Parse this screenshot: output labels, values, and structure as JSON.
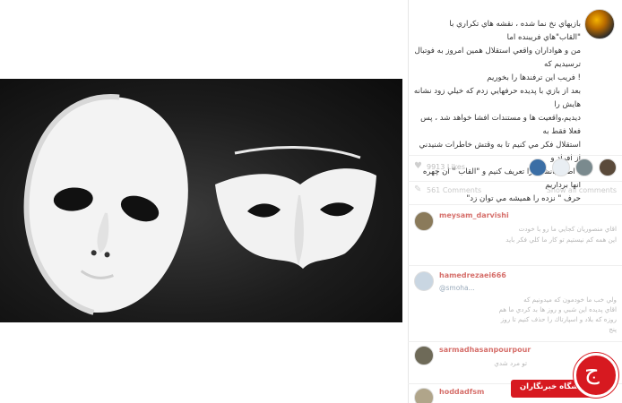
{
  "post": {
    "caption_lines": [
      "بازيهاي نخ نما شده ، نقشه هاي تكراري با \"القاب\"هاي فريبنده اما",
      "من و هواداران واقعي استقلال همين امروز به فوتبال ترسيديم كه",
      "! فريب اين ترفندها را بخوريم",
      "بعد از بازي با پديده حرفهايي زدم كه خيلي زود نشانه هايش را",
      "ديديم،واقعيت ها و مستندات افشا خواهد شد ، پس فعلا فقط به",
      "استقلال فكر مي كنيم تا به وقتش خاطرات شنيدني از افراد و",
      "! اطرافيانشان را تعريف كنيم و \"القاب \" ان چهره انها برداريم",
      "حرف \" نزده را هميشه مي توان زد\""
    ],
    "likes_text": "9913 Likes",
    "comments_text": "561 Comments",
    "view_all_text": "Show all comments"
  },
  "comments": [
    {
      "user": "meysam_darvishi",
      "date": "",
      "lines": [
        "اقاي منصوريان كجايي ما رو با خودت",
        "اين همه كم نيستيم تو كار ما كلي فكر بايد"
      ]
    },
    {
      "user": "hamedrezaei666",
      "date": "Show all comments",
      "mention": "@smoha... ",
      "lines": [
        "ولي خب ما خودمون كه ميدونيم كه",
        "اقاي پديده اين شبي و روز ها بد كردي ما هم",
        "روزه كه بلاد و اسپارتاك را حذف كنيم تا روز",
        "پنج"
      ]
    },
    {
      "user": "sarmadhasanpourpour",
      "date": "",
      "lines": [
        "تو مرد شدي"
      ]
    },
    {
      "user": "hoddadfsm",
      "date": "",
      "lines": []
    }
  ],
  "watermark": {
    "text": "باشگاه خبرنگاران",
    "glyph": "ج"
  },
  "colors": {
    "accent_red": "#d71920",
    "username_red": "#c9403a"
  }
}
